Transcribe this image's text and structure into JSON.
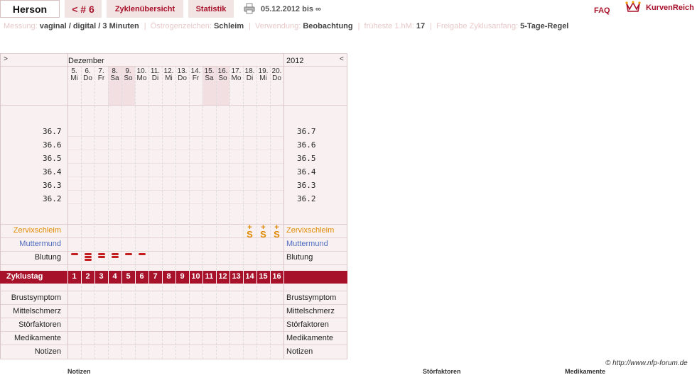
{
  "header": {
    "user_name": "Herson",
    "cycle_nav": "< # 6",
    "cycle_overview": "Zyklenübersicht",
    "statistics": "Statistik",
    "date_range": "05.12.2012 bis ∞",
    "faq": "FAQ",
    "brand": "KurvenReich"
  },
  "settings": [
    {
      "label": "Messung:",
      "value": "vaginal / digital / 3 Minuten"
    },
    {
      "label": "Östrogenzeichen:",
      "value": "Schleim"
    },
    {
      "label": "Verwendung:",
      "value": "Beobachtung"
    },
    {
      "label": "früheste 1.hM:",
      "value": "17"
    },
    {
      "label": "Freigabe Zyklusanfang:",
      "value": "5-Tage-Regel"
    }
  ],
  "chart": {
    "nav_left": ">",
    "nav_right": "<",
    "month": "Dezember",
    "year": "2012",
    "days": [
      {
        "num": "5.",
        "wd": "Mi",
        "weekend": false
      },
      {
        "num": "6.",
        "wd": "Do",
        "weekend": false
      },
      {
        "num": "7.",
        "wd": "Fr",
        "weekend": false
      },
      {
        "num": "8.",
        "wd": "Sa",
        "weekend": true
      },
      {
        "num": "9.",
        "wd": "So",
        "weekend": true
      },
      {
        "num": "10.",
        "wd": "Mo",
        "weekend": false
      },
      {
        "num": "11.",
        "wd": "Di",
        "weekend": false
      },
      {
        "num": "12.",
        "wd": "Mi",
        "weekend": false
      },
      {
        "num": "13.",
        "wd": "Do",
        "weekend": false
      },
      {
        "num": "14.",
        "wd": "Fr",
        "weekend": false
      },
      {
        "num": "15.",
        "wd": "Sa",
        "weekend": true
      },
      {
        "num": "16.",
        "wd": "So",
        "weekend": true
      },
      {
        "num": "17.",
        "wd": "Mo",
        "weekend": false
      },
      {
        "num": "18.",
        "wd": "Di",
        "weekend": false
      },
      {
        "num": "19.",
        "wd": "Mi",
        "weekend": false
      },
      {
        "num": "20.",
        "wd": "Do",
        "weekend": false
      }
    ],
    "temperatures": [
      "36.7",
      "36.6",
      "36.5",
      "36.4",
      "36.3",
      "36.2"
    ],
    "cervix_label": "Zervixschleim",
    "cervix_marks": [
      {
        "day": 14,
        "sym": "S+"
      },
      {
        "day": 15,
        "sym": "S+"
      },
      {
        "day": 16,
        "sym": "S+"
      }
    ],
    "cervix_sym_top": "+",
    "cervix_sym_main": "S",
    "os_label": "Muttermund",
    "bleeding_label": "Blutung",
    "bleeding": [
      1,
      3,
      2,
      2,
      1,
      1
    ],
    "cycle_day_label": "Zyklustag",
    "cycle_days": [
      "1",
      "2",
      "3",
      "4",
      "5",
      "6",
      "7",
      "8",
      "9",
      "10",
      "11",
      "12",
      "13",
      "14",
      "15",
      "16"
    ],
    "extra_rows": [
      "Brustsymptom",
      "Mittelschmerz",
      "Störfaktoren",
      "Medikamente",
      "Notizen"
    ]
  },
  "footer": {
    "copyright": "© http://www.nfp-forum.de",
    "notes": "Notizen",
    "disturbances": "Störfaktoren",
    "medication": "Medikamente"
  }
}
